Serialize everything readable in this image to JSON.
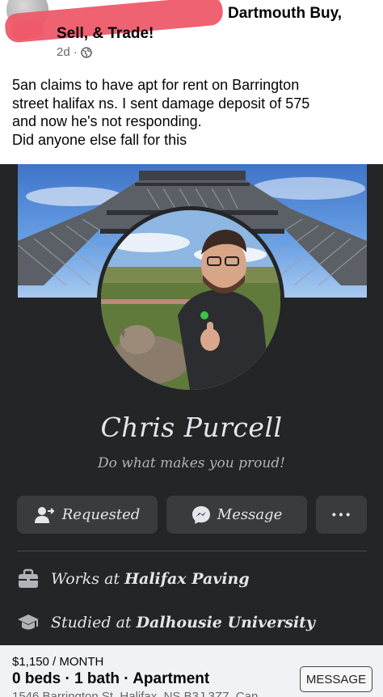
{
  "post": {
    "group_line1": "Dartmouth Buy,",
    "group_line2": "Sell, & Trade!",
    "time": "2d ·",
    "text_line1": "5an claims to have apt for rent on Barrington",
    "text_line2": "street halifax ns. I sent damage deposit of 575",
    "text_line3": "and now he's not responding.",
    "text_line4": "Did anyone else fall for this"
  },
  "profile": {
    "name": "Chris Purcell",
    "bio": "Do what makes you proud!",
    "buttons": {
      "requested": "Requested",
      "message": "Message",
      "more": "···"
    },
    "work_prefix": "Works at ",
    "work_place": "Halifax Paving",
    "school_prefix": "Studied at ",
    "school_place": "Dalhousie University"
  },
  "listing": {
    "price": "$1,150 / MONTH",
    "specs": "0 beds · 1 bath · Apartment",
    "address": "1546 Barrington St, Halifax, NS B3J 3Z7, Can",
    "message_button": "MESSAGE"
  },
  "icons": {
    "globe": "globe-icon",
    "add_friend": "person-arrow-icon",
    "messenger": "messenger-icon",
    "briefcase": "briefcase-icon",
    "graduation": "graduation-cap-icon"
  },
  "colors": {
    "profile_bg": "#242526",
    "button_bg": "#3a3b3c",
    "redaction": "#ee5a6a"
  }
}
